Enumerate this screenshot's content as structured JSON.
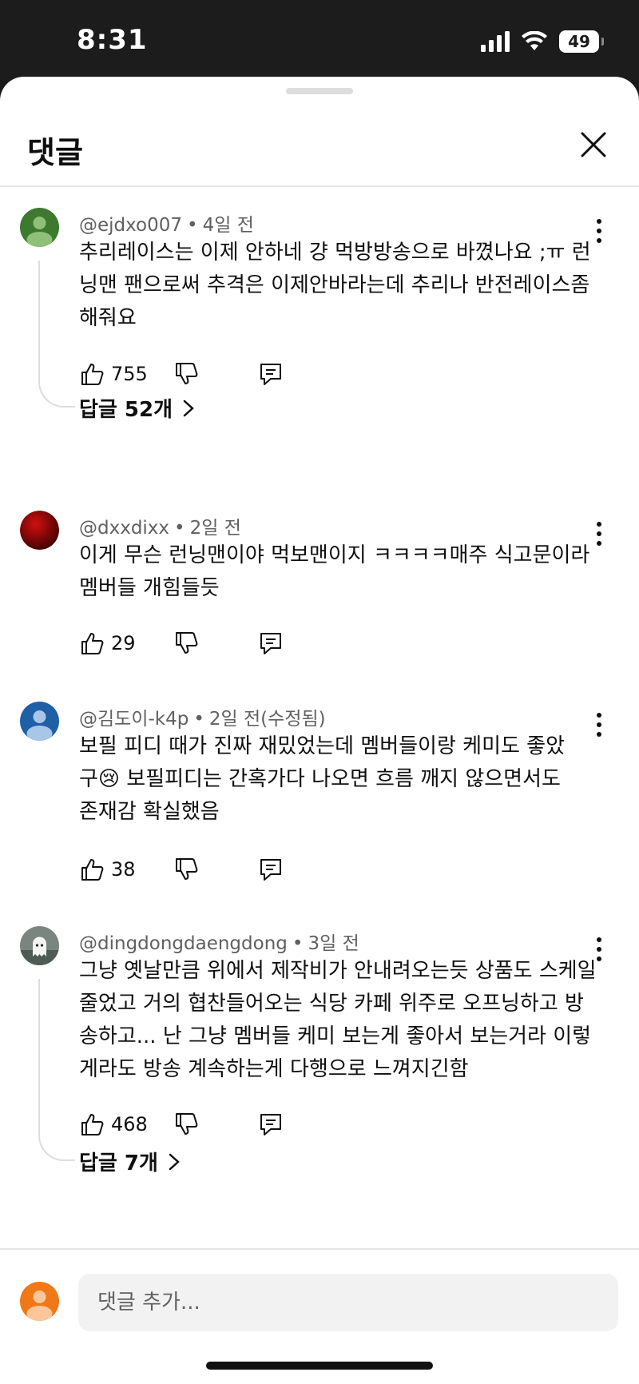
{
  "status": {
    "time": "8:31",
    "battery": "49"
  },
  "header": {
    "title": "댓글",
    "close_icon": "close-icon"
  },
  "comments": [
    {
      "author": "@ejdxo007",
      "age": "4일 전",
      "text": "추리레이스는 이제 안하네 걍 먹방방송으로 바꼈나요 ;ㅠ 런닝맨 팬으로써 추격은 이제안바라는데 추리나 반전레이스좀 해줘요",
      "likes": "755",
      "replies": "답글 52개",
      "avatar_color": "#3d7a2f"
    },
    {
      "author": "@dxxdixx",
      "age": "2일 전",
      "text": "이게 무슨 런닝맨이야 먹보맨이지 ㅋㅋㅋㅋ매주 식고문이라 멤버들 개힘들듯",
      "likes": "29",
      "avatar_color": "#a00000"
    },
    {
      "author": "@김도이-k4p",
      "age": "2일 전(수정됨)",
      "text_line1": "보필 피디 때가 진짜 재밌었는데 멤버들이랑 케미도 좋았",
      "text_line2_prefix": "구",
      "emoji": "😢",
      "text_line2_suffix": " 보필피디는 간혹가다 나오면 흐름 깨지 않으면서도",
      "text_line3": "존재감 확실했음",
      "likes": "38",
      "avatar_color": "#1e5fa6"
    },
    {
      "author": "@dingdongdaengdong",
      "age": "3일 전",
      "text": "그냥 옛날만큼 위에서 제작비가 안내려오는듯 상품도 스케일 줄었고 거의 협찬들어오는 식당 카페 위주로 오프닝하고 방송하고... 난 그냥 멤버들 케미 보는게 좋아서 보는거라 이렇게라도 방송 계속하는게 다행으로 느껴지긴함",
      "likes": "468",
      "replies": "답글 7개"
    }
  ],
  "input": {
    "placeholder": "댓글 추가...",
    "avatar_color": "#f07818"
  }
}
